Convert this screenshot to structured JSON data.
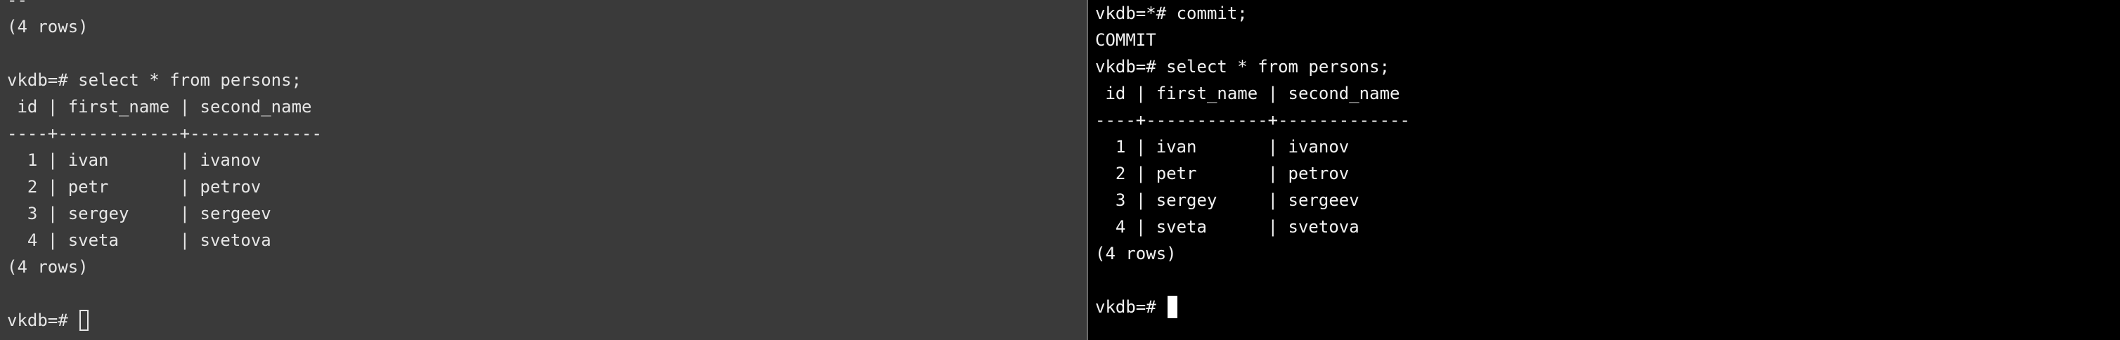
{
  "left_pane": {
    "top_partial": "--",
    "lines": [
      "(4 rows)",
      "",
      "vkdb=# select * from persons;",
      " id | first_name | second_name",
      "----+------------+-------------",
      "  1 | ivan       | ivanov",
      "  2 | petr       | petrov",
      "  3 | sergey     | sergeev",
      "  4 | sveta      | svetova",
      "(4 rows)",
      ""
    ],
    "prompt": "vkdb=# ",
    "cursor": "hollow-block"
  },
  "right_pane": {
    "lines": [
      "vkdb=*# commit;",
      "COMMIT",
      "vkdb=# select * from persons;",
      " id | first_name | second_name",
      "----+------------+-------------",
      "  1 | ivan       | ivanov",
      "  2 | petr       | petrov",
      "  3 | sergey     | sergeev",
      "  4 | sveta      | svetova",
      "(4 rows)",
      ""
    ],
    "prompt": "vkdb=# ",
    "cursor": "solid-block"
  },
  "colors": {
    "left_background": "#3a3a3a",
    "right_background": "#000000",
    "text": "#e6e6e6"
  }
}
